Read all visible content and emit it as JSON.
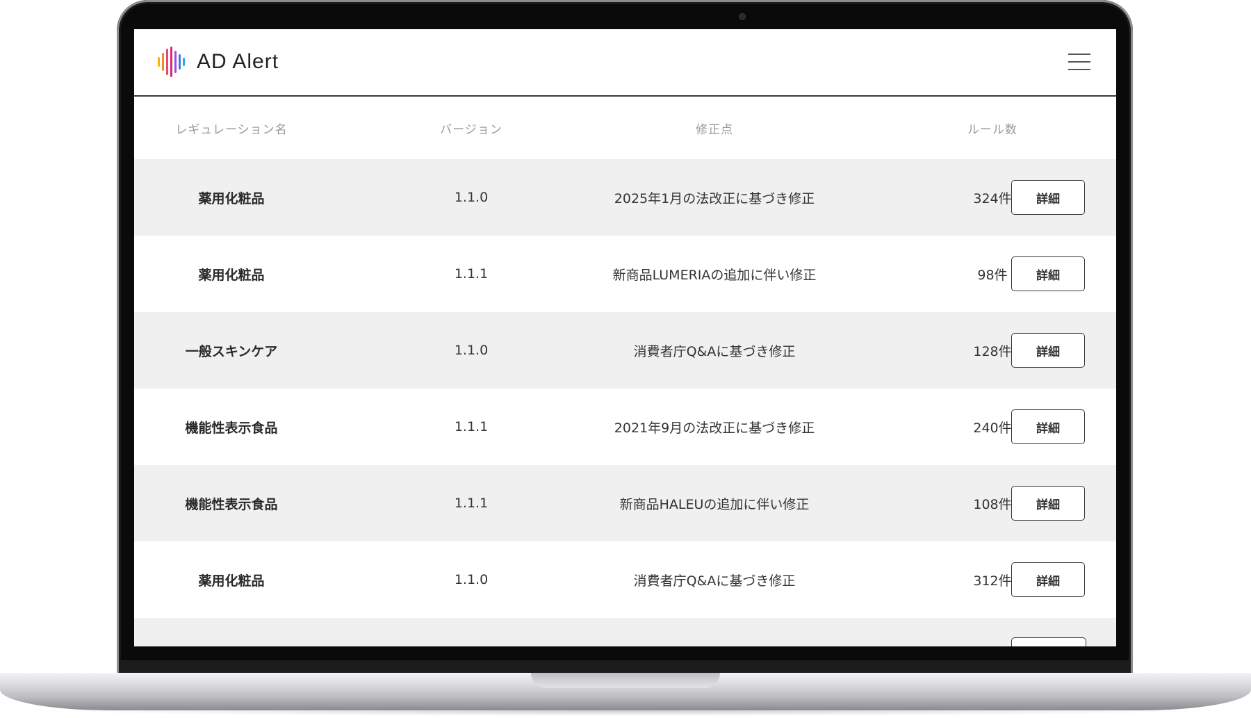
{
  "app": {
    "brand_name": "AD Alert",
    "logo_colors": [
      "#f7b500",
      "#f08a24",
      "#e8496b",
      "#d6287a",
      "#a44bd6",
      "#3b7be0",
      "#29a9e0"
    ]
  },
  "header": {
    "menu_icon": "hamburger-menu-icon"
  },
  "table": {
    "columns": {
      "name": "レギュレーション名",
      "version": "バージョン",
      "note": "修正点",
      "count": "ルール数"
    },
    "rows": [
      {
        "name": "薬用化粧品",
        "version": "1.1.0",
        "note": "2025年1月の法改正に基づき修正",
        "count": "324件",
        "action": "詳細"
      },
      {
        "name": "薬用化粧品",
        "version": "1.1.1",
        "note": "新商品LUMERIAの追加に伴い修正",
        "count": "98件",
        "action": "詳細"
      },
      {
        "name": "一般スキンケア",
        "version": "1.1.0",
        "note": "消費者庁Q&Aに基づき修正",
        "count": "128件",
        "action": "詳細"
      },
      {
        "name": "機能性表示食品",
        "version": "1.1.1",
        "note": "2021年9月の法改正に基づき修正",
        "count": "240件",
        "action": "詳細"
      },
      {
        "name": "機能性表示食品",
        "version": "1.1.1",
        "note": "新商品HALEUの追加に伴い修正",
        "count": "108件",
        "action": "詳細"
      },
      {
        "name": "薬用化粧品",
        "version": "1.1.0",
        "note": "消費者庁Q&Aに基づき修正",
        "count": "312件",
        "action": "詳細"
      }
    ]
  }
}
